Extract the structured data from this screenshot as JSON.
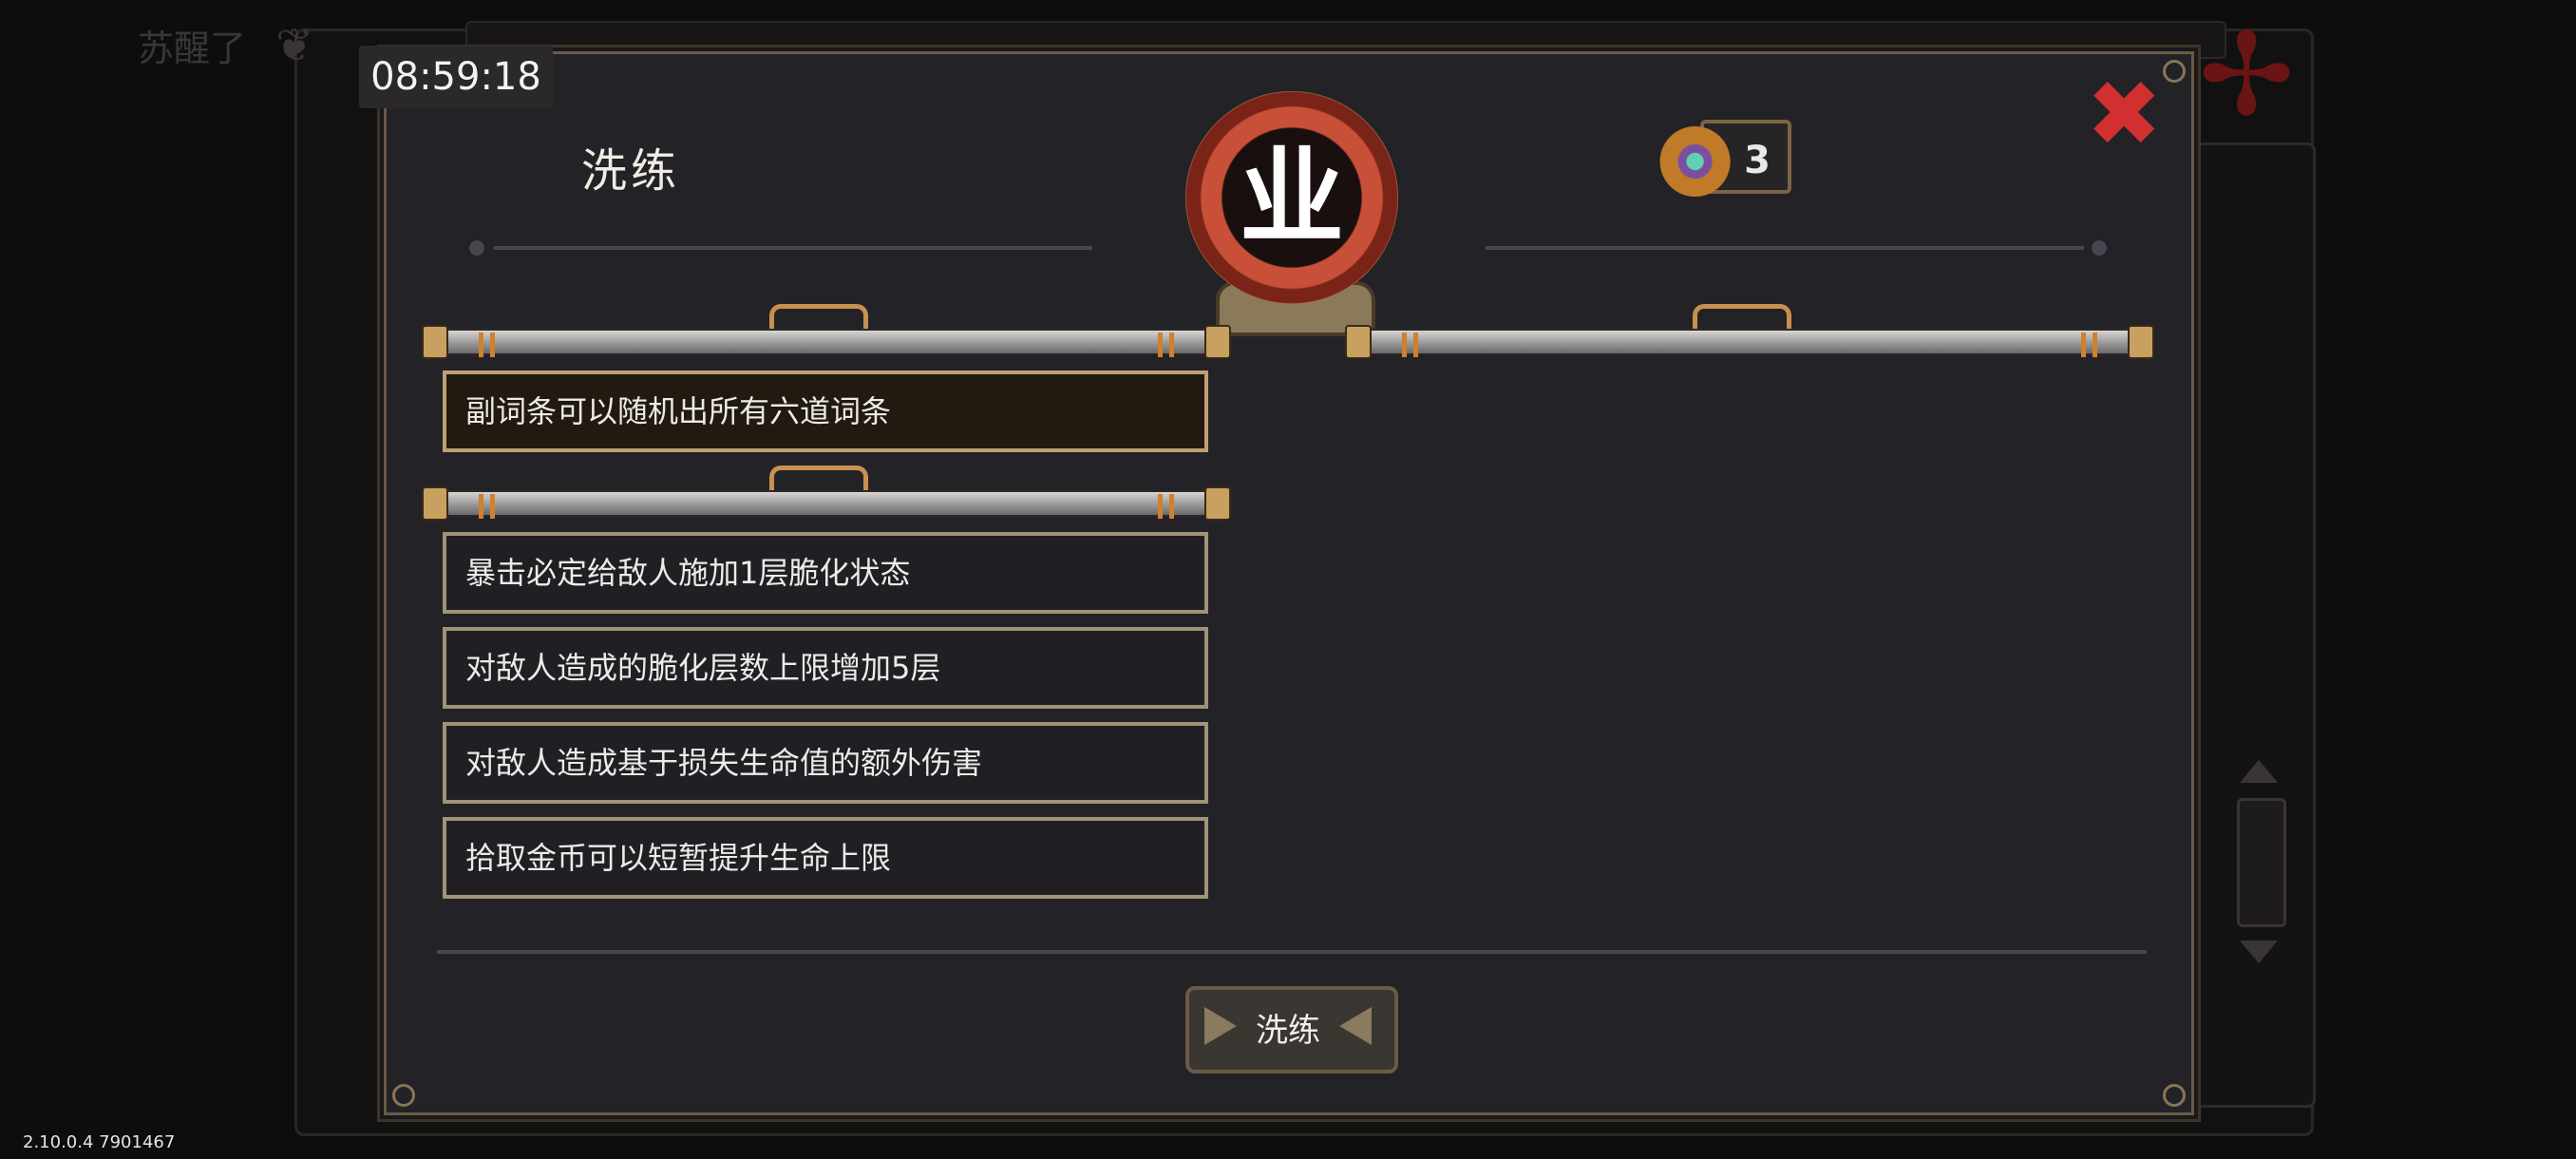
{
  "status_bar": {
    "time": "08:59:18"
  },
  "background": {
    "partial_title": "苏醒了",
    "pinwheel_icon": "pinwheel-icon"
  },
  "dialog": {
    "title": "洗练",
    "emblem_glyph": "业",
    "currency": {
      "icon": "eye-gem-icon",
      "count": "3"
    },
    "close_icon": "close-icon"
  },
  "selected_effect": {
    "label": "副词条可以随机出所有六道词条"
  },
  "effects": [
    {
      "label": "暴击必定给敌人施加1层脆化状态"
    },
    {
      "label": "对敌人造成的脆化层数上限增加5层"
    },
    {
      "label": "对敌人造成基于损失生命值的额外伤害"
    },
    {
      "label": "拾取金币可以短暂提升生命上限"
    }
  ],
  "action_button": {
    "label": "洗练"
  },
  "version": "2.10.0.4 7901467",
  "colors": {
    "panel": "#232226",
    "border": "#a09478",
    "close": "#d23030",
    "emblem_red": "#c95038"
  }
}
